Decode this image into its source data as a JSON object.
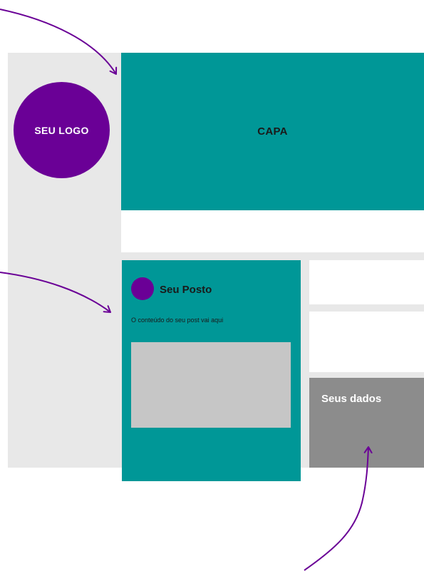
{
  "logo": {
    "label": "SEU LOGO"
  },
  "cover": {
    "label": "CAPA"
  },
  "post": {
    "title": "Seu Posto",
    "text": "O conteúdo do seu post vai aqui"
  },
  "data_box": {
    "label": "Seus dados"
  },
  "colors": {
    "teal": "#009797",
    "purple": "#6a0096",
    "light_gray": "#e8e8e8",
    "image_gray": "#c6c6c6",
    "dark_gray": "#8c8c8c"
  }
}
